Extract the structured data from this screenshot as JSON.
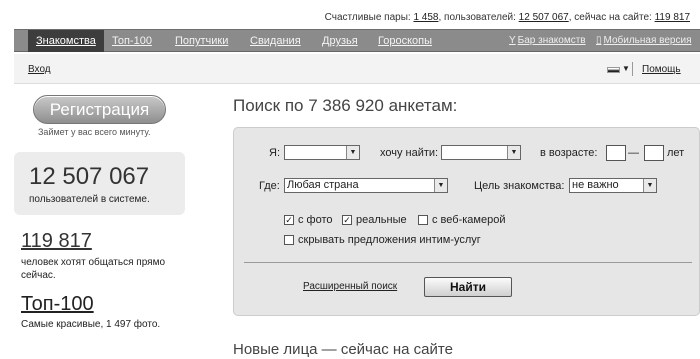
{
  "header": {
    "couples_label": "Счастливые пары:",
    "couples": "1 458",
    "users_label": ", пользователей:",
    "users": "12 507 067",
    "online_label": ", сейчас на сайте:",
    "online": "119 817"
  },
  "nav": {
    "items": [
      "Знакомства",
      "Топ-100",
      "Попутчики",
      "Свидания",
      "Друзья",
      "Гороскопы"
    ],
    "bar": "Бар знакомств",
    "mobile": "Мобильная версия"
  },
  "subbar": {
    "login": "Вход",
    "help": "Помощь"
  },
  "sidebar": {
    "register": "Регистрация",
    "register_hint": "Займет у вас всего минуту.",
    "users_num": "12 507 067",
    "users_caption": "пользователей в системе.",
    "online_num": "119 817",
    "online_caption": "человек хотят общаться прямо сейчас.",
    "top_title": "Топ-100",
    "top_caption": "Самые красивые, 1 497 фото."
  },
  "search": {
    "title": "Поиск по 7 386 920 анкетам:",
    "i_label": "Я:",
    "i_value": "",
    "want_label": "хочу найти:",
    "want_value": "",
    "age_label": "в возрасте:",
    "age_dash": "—",
    "age_unit": "лет",
    "age_from": "",
    "age_to": "",
    "where_label": "Где:",
    "where_value": "Любая страна",
    "goal_label": "Цель знакомства:",
    "goal_value": "не важно",
    "chk_photo": "с фото",
    "chk_real": "реальные",
    "chk_webcam": "с веб-камерой",
    "chk_hide": "скрывать предложения интим-услуг",
    "advanced": "Расширенный поиск",
    "find": "Найти"
  },
  "new_faces": "Новые лица — сейчас на сайте",
  "icons": {
    "check": "✓",
    "dropdown": "▼",
    "bar": "Y",
    "mobile": "▯"
  }
}
